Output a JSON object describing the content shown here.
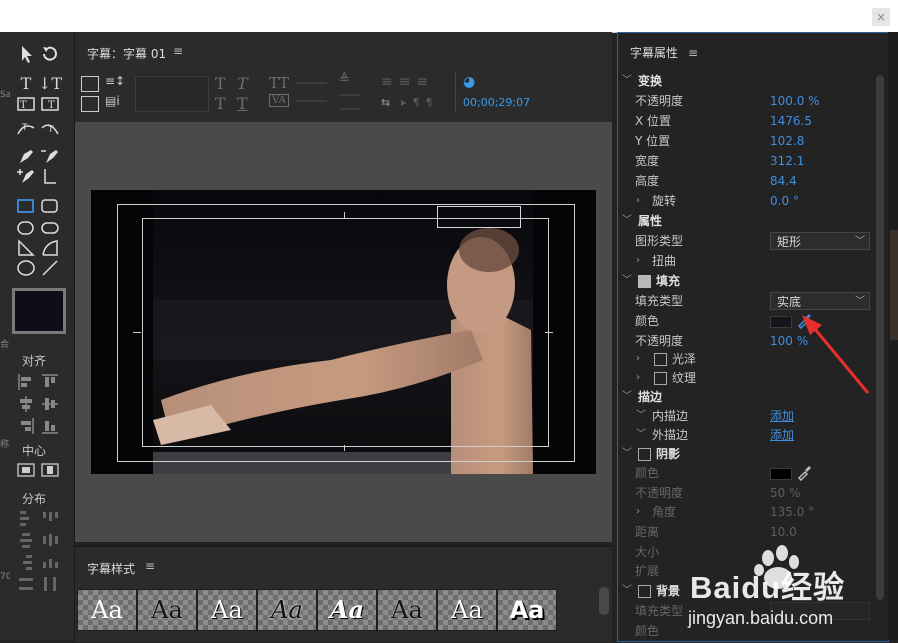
{
  "window": {
    "close_label": "×"
  },
  "left_edge": {
    "frag1": "Sa",
    "frag2": "合",
    "frag3": "称",
    "frag4": "70"
  },
  "tools": {
    "align_label": "对齐",
    "center_label": "中心",
    "distribute_label": "分布"
  },
  "designer": {
    "title": "字幕：字幕 01",
    "menu_icon": "≡",
    "timecode": "00;00;29;07"
  },
  "styles": {
    "title": "字幕样式",
    "menu_icon": "≡",
    "tiles": [
      "Aa",
      "Aa",
      "Aa",
      "Aa",
      "Aa",
      "Aa",
      "Aa",
      "Aa"
    ]
  },
  "properties": {
    "title": "字幕属性",
    "menu_icon": "≡",
    "transform": {
      "label": "变换",
      "opacity_label": "不透明度",
      "opacity": "100.0 %",
      "x_label": "X 位置",
      "x": "1476.5",
      "y_label": "Y 位置",
      "y": "102.8",
      "width_label": "宽度",
      "width": "312.1",
      "height_label": "高度",
      "height": "84.4",
      "rotation_label": "旋转",
      "rotation": "0.0 °"
    },
    "attributes": {
      "label": "属性",
      "shape_type_label": "图形类型",
      "shape_type": "矩形",
      "distort_label": "扭曲"
    },
    "fill": {
      "label": "填充",
      "fill_type_label": "填充类型",
      "fill_type": "实底",
      "color_label": "颜色",
      "opacity_label": "不透明度",
      "opacity": "100 %",
      "sheen_label": "光泽",
      "texture_label": "纹理"
    },
    "strokes": {
      "label": "描边",
      "inner_label": "内描边",
      "inner_action": "添加",
      "outer_label": "外描边",
      "outer_action": "添加"
    },
    "shadow": {
      "label": "阴影",
      "color_label": "颜色",
      "opacity_label": "不透明度",
      "opacity": "50 %",
      "angle_label": "角度",
      "angle": "135.0 °",
      "distance_label": "距离",
      "distance": "10.0",
      "size_label": "大小",
      "spread_label": "扩展"
    },
    "background": {
      "label": "背景",
      "fill_type_label": "填充类型",
      "color_label": "颜色"
    }
  },
  "colors": {
    "accent": "#3f8fe0",
    "annotation_arrow": "#e8302a",
    "selection_border": "#2f5f9a"
  },
  "watermark": {
    "brand": "Baidu经验",
    "url": "jingyan.baidu.com"
  }
}
